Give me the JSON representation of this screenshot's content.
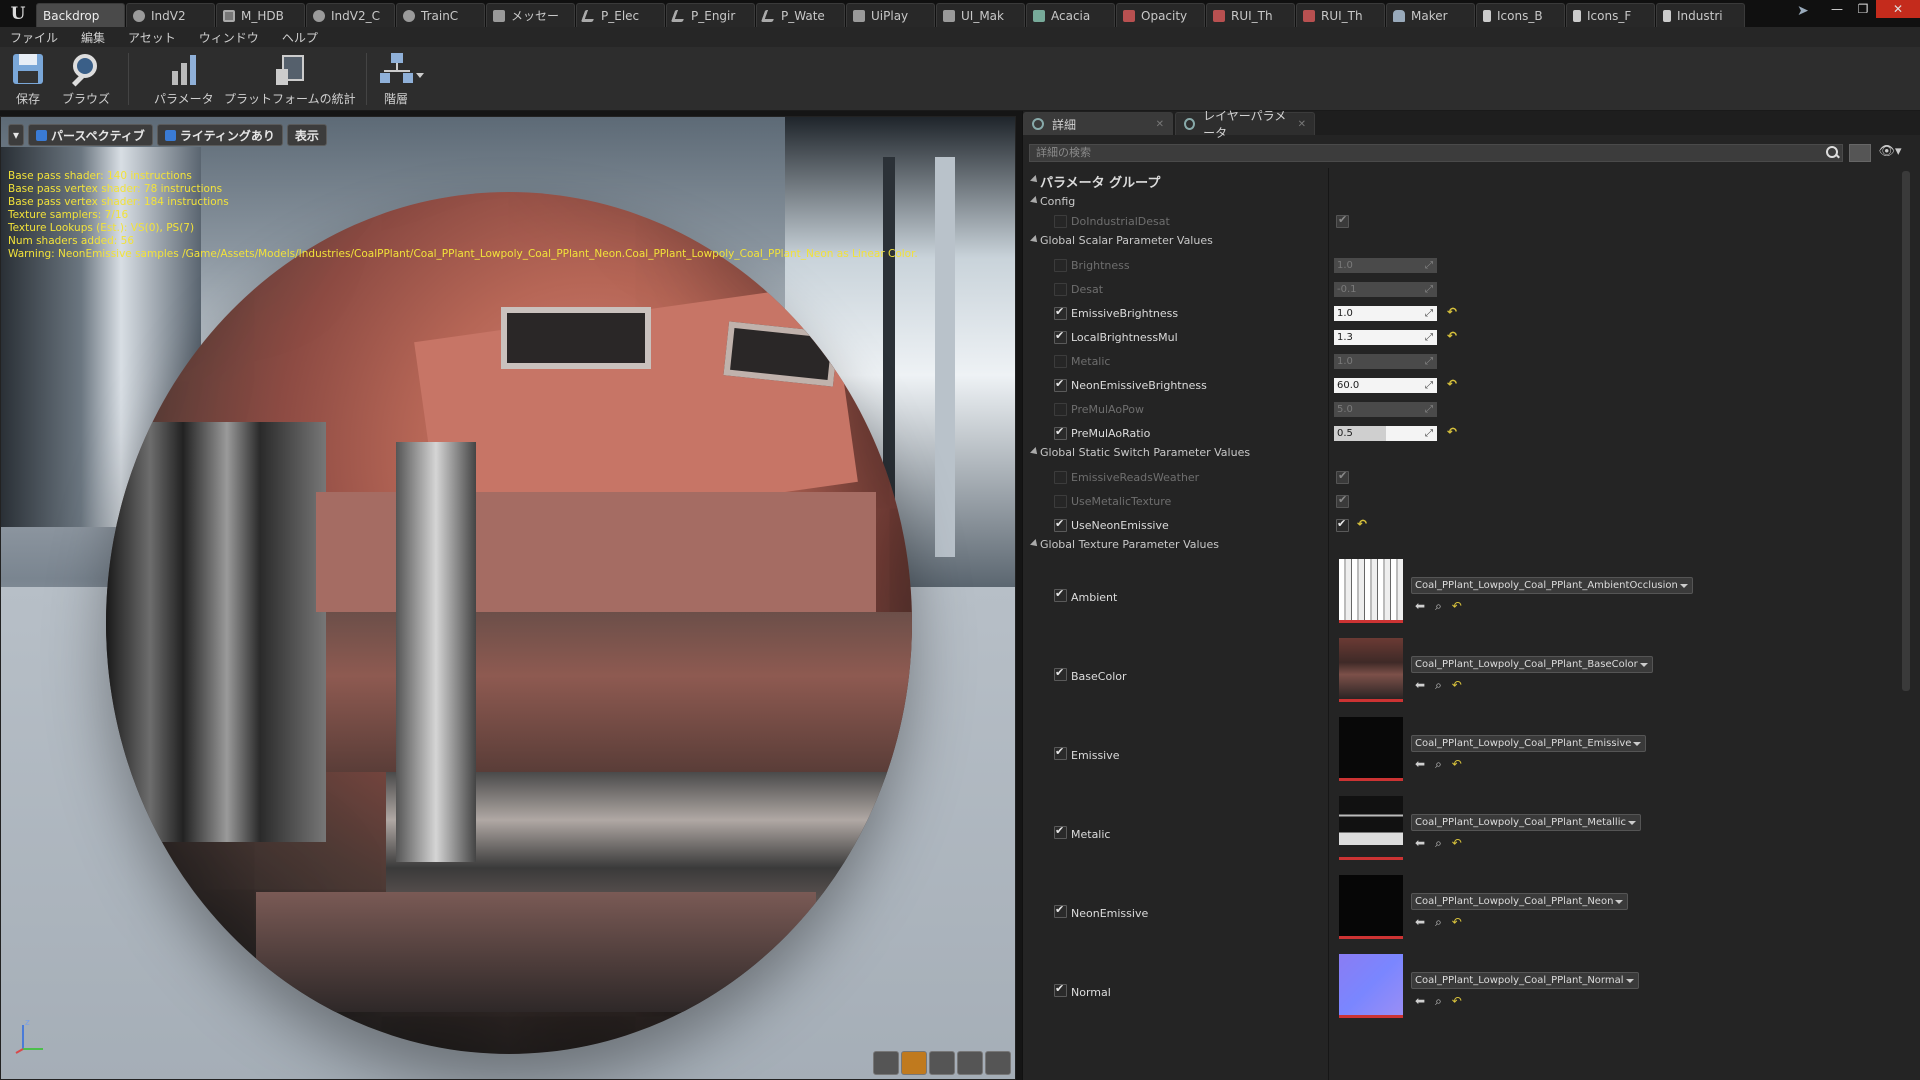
{
  "tabs": [
    {
      "label": "Backdrop",
      "icon": "ue-icon"
    },
    {
      "label": "IndV2",
      "icon": "material-icon"
    },
    {
      "label": "M_HDB",
      "icon": "material-instance-icon"
    },
    {
      "label": "IndV2_C",
      "icon": "material-icon"
    },
    {
      "label": "TrainC",
      "icon": "material-icon"
    },
    {
      "label": "メッセー",
      "icon": "message-icon"
    },
    {
      "label": "P_Elec",
      "icon": "pipe-icon"
    },
    {
      "label": "P_Engir",
      "icon": "pipe-icon"
    },
    {
      "label": "P_Wate",
      "icon": "pipe-icon"
    },
    {
      "label": "UiPlay",
      "icon": "widget-icon"
    },
    {
      "label": "UI_Mak",
      "icon": "widget-icon"
    },
    {
      "label": "Acacia",
      "icon": "tree-icon"
    },
    {
      "label": "Opacity",
      "icon": "texture-icon"
    },
    {
      "label": "RUI_Th",
      "icon": "texture-icon"
    },
    {
      "label": "RUI_Th",
      "icon": "texture-icon"
    },
    {
      "label": "Maker",
      "icon": "figure-icon"
    },
    {
      "label": "Icons_B",
      "icon": "book-icon"
    },
    {
      "label": "Icons_F",
      "icon": "book-icon"
    },
    {
      "label": "Industri",
      "icon": "book-icon"
    }
  ],
  "menu": [
    "ファイル",
    "編集",
    "アセット",
    "ウィンドウ",
    "ヘルプ"
  ],
  "toolbar": {
    "save": "保存",
    "browse": "ブラウズ",
    "params": "パラメータ",
    "platform_stats": "プラットフォームの統計",
    "hierarchy": "階層"
  },
  "viewport": {
    "perspective": "パースペクティブ",
    "lighting": "ライティングあり",
    "show": "表示",
    "stats": [
      "Base pass shader: 140 instructions",
      "Base pass vertex shader: 78 instructions",
      "Base pass vertex shader: 184 instructions",
      "Texture samplers: 7/16",
      "Texture Lookups (Est.): VS(0), PS(7)",
      "Num shaders added: 56"
    ],
    "warning": "Warning: NeonEmissive samples /Game/Assets/Models/Industries/CoalPPlant/Coal_PPlant_Lowpoly_Coal_PPlant_Neon.Coal_PPlant_Lowpoly_Coal_PPlant_Neon as Linear Color."
  },
  "details": {
    "tab_details": "詳細",
    "tab_layer": "レイヤーパラメータ",
    "search_placeholder": "詳細の検索",
    "group_header": "パラメータ グループ",
    "cat_config": "Config",
    "cat_scalar": "Global Scalar Parameter Values",
    "cat_switch": "Global Static Switch Parameter Values",
    "cat_texture": "Global Texture Parameter Values",
    "config": [
      {
        "name": "DoIndustrialDesat",
        "enabled": false
      }
    ],
    "scalars": [
      {
        "name": "Brightness",
        "enabled": false,
        "value": "1.0"
      },
      {
        "name": "Desat",
        "enabled": false,
        "value": "-0.1"
      },
      {
        "name": "EmissiveBrightness",
        "enabled": true,
        "value": "1.0"
      },
      {
        "name": "LocalBrightnessMul",
        "enabled": true,
        "value": "1.3"
      },
      {
        "name": "Metalic",
        "enabled": false,
        "value": "1.0"
      },
      {
        "name": "NeonEmissiveBrightness",
        "enabled": true,
        "value": "60.0"
      },
      {
        "name": "PreMulAoPow",
        "enabled": false,
        "value": "5.0"
      },
      {
        "name": "PreMulAoRatio",
        "enabled": true,
        "value": "0.5",
        "slider_fraction": 0.5
      }
    ],
    "switches": [
      {
        "name": "EmissiveReadsWeather",
        "enabled": false
      },
      {
        "name": "UseMetalicTexture",
        "enabled": false
      },
      {
        "name": "UseNeonEmissive",
        "enabled": true
      }
    ],
    "textures": [
      {
        "name": "Ambient",
        "asset": "Coal_PPlant_Lowpoly_Coal_PPlant_AmbientOcclusion"
      },
      {
        "name": "BaseColor",
        "asset": "Coal_PPlant_Lowpoly_Coal_PPlant_BaseColor"
      },
      {
        "name": "Emissive",
        "asset": "Coal_PPlant_Lowpoly_Coal_PPlant_Emissive"
      },
      {
        "name": "Metalic",
        "asset": "Coal_PPlant_Lowpoly_Coal_PPlant_Metallic"
      },
      {
        "name": "NeonEmissive",
        "asset": "Coal_PPlant_Lowpoly_Coal_PPlant_Neon"
      },
      {
        "name": "Normal",
        "asset": "Coal_PPlant_Lowpoly_Coal_PPlant_Normal"
      }
    ]
  },
  "colors": {
    "accent": "#c07a1e",
    "reset_arrow": "#d8c23c",
    "stats_text": "#f2e23a"
  }
}
